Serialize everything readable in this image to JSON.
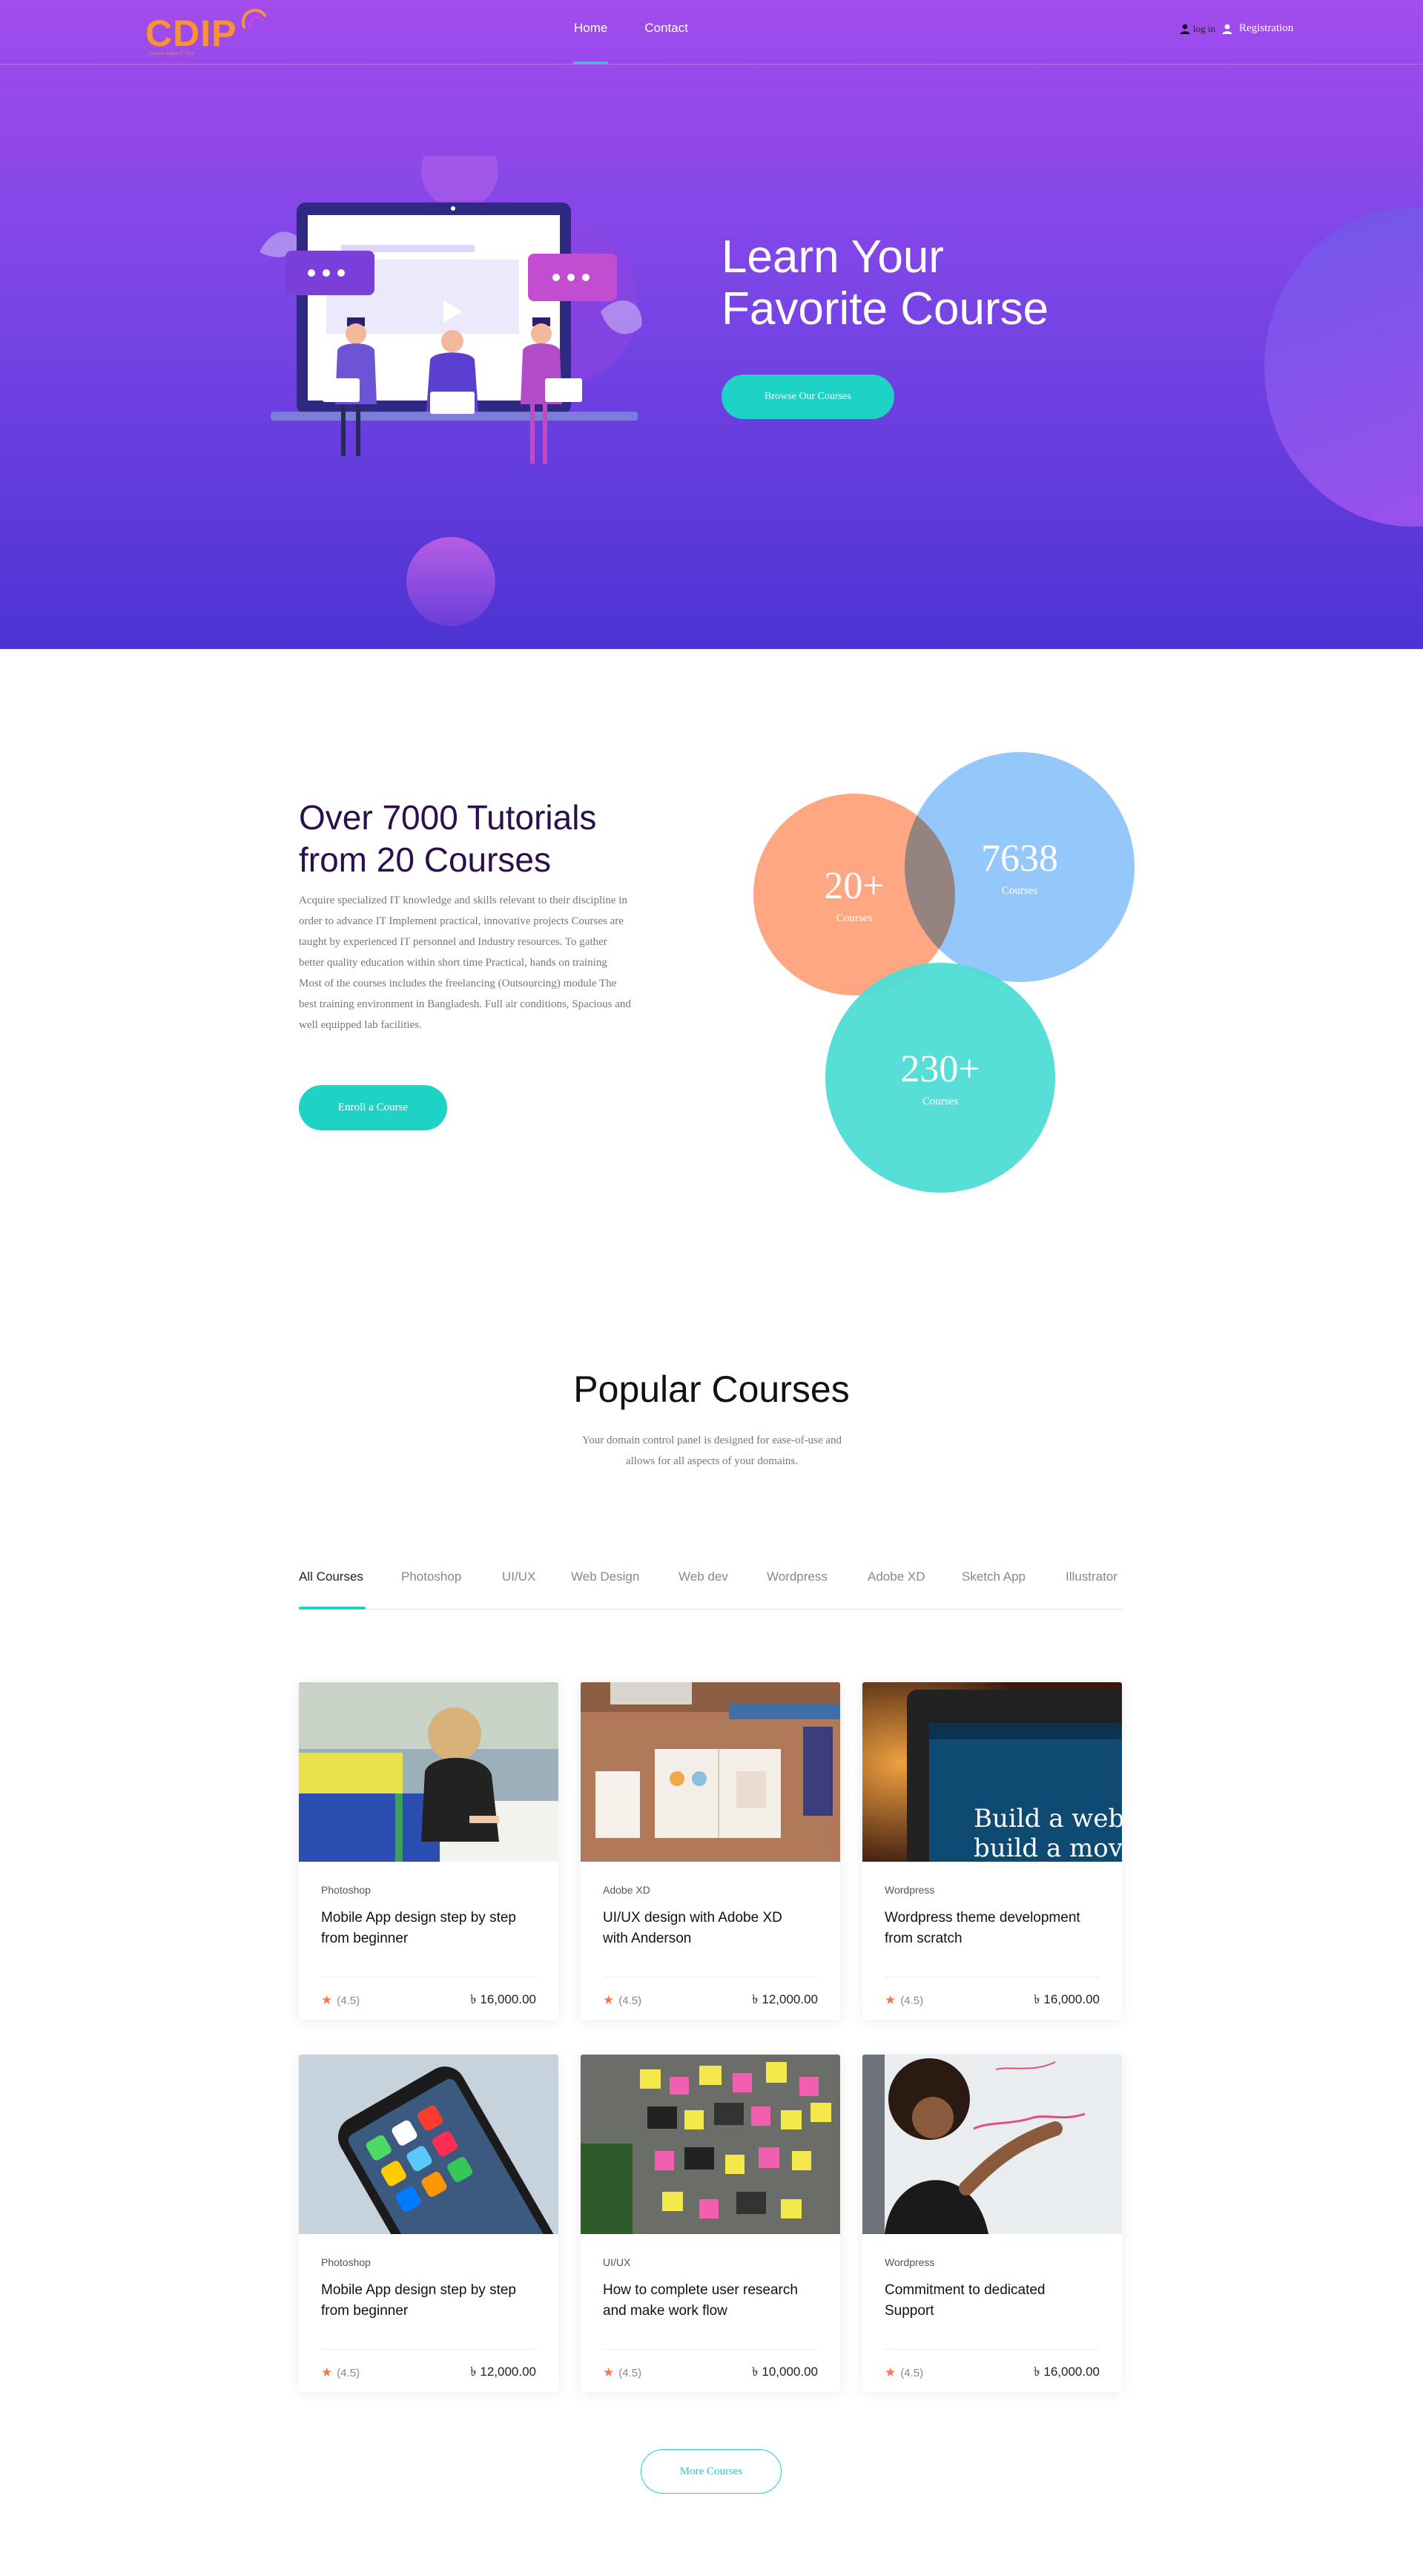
{
  "nav": {
    "logo_text": "CDIP",
    "logo_tagline": "Creative Digital IT Park",
    "links": [
      {
        "label": "Home",
        "active": true
      },
      {
        "label": "Contact",
        "active": false
      }
    ],
    "login_label": "log in",
    "register_label": "Registration"
  },
  "hero": {
    "title_line1": "Learn Your",
    "title_line2": "Favorite Course",
    "button_label": "Browse Our Courses",
    "colors": {
      "gradient_top": "#a24ced",
      "gradient_bottom": "#4d33d3",
      "accent": "#1ed2c6"
    }
  },
  "stats": {
    "title_line1": "Over 7000 Tutorials",
    "title_line2": "from 20 Courses",
    "description": "Acquire specialized IT knowledge and skills relevant to their discipline in order to advance IT Implement practical, innovative projects Courses are taught by experienced IT personnel and Industry resources. To gather better quality education within short time Practical, hands on training Most of the courses includes the freelancing (Outsourcing) module The best training environment in Bangladesh. Full air conditions, Spacious and well equipped lab facilities.",
    "button_label": "Enroll a Course",
    "circles": [
      {
        "value": "20+",
        "label": "Courses",
        "color": "#ffa078"
      },
      {
        "value": "7638",
        "label": "Courses",
        "color": "#8cc3fa"
      },
      {
        "value": "230+",
        "label": "Courses",
        "color": "#4edcd4"
      }
    ]
  },
  "popular": {
    "title": "Popular Courses",
    "subtitle_line1": "Your domain control panel is designed for ease-of-use and",
    "subtitle_line2": "allows for all aspects of your domains.",
    "tabs": [
      "All Courses",
      "Photoshop",
      "UI/UX",
      "Web Design",
      "Web dev",
      "Wordpress",
      "Adobe XD",
      "Sketch App",
      "Illustrator"
    ],
    "courses": [
      {
        "category": "Photoshop",
        "title_line1": "Mobile App design step by step",
        "title_line2": "from beginner",
        "rating": "(4.5)",
        "price": "৳ 16,000.00",
        "image": "child-drawing-photo"
      },
      {
        "category": "Adobe XD",
        "title_line1": "UI/UX design with Adobe XD",
        "title_line2": "with Anderson",
        "rating": "(4.5)",
        "price": "৳ 12,000.00",
        "image": "desk-design-book-photo"
      },
      {
        "category": "Wordpress",
        "title_line1": "Wordpress theme development",
        "title_line2": "from scratch",
        "rating": "(4.5)",
        "price": "৳ 16,000.00",
        "image": "wordpress-laptop-photo"
      },
      {
        "category": "Photoshop",
        "title_line1": "Mobile App design step by step",
        "title_line2": "from beginner",
        "rating": "(4.5)",
        "price": "৳ 12,000.00",
        "image": "smartphone-apps-photo"
      },
      {
        "category": "UI/UX",
        "title_line1": "How to complete user research",
        "title_line2": "and make work flow",
        "rating": "(4.5)",
        "price": "৳ 10,000.00",
        "image": "sticky-notes-wall-photo"
      },
      {
        "category": "Wordpress",
        "title_line1": "Commitment to dedicated",
        "title_line2": "Support",
        "rating": "(4.5)",
        "price": "৳ 16,000.00",
        "image": "whiteboard-writing-photo"
      }
    ],
    "more_label": "More Courses"
  }
}
